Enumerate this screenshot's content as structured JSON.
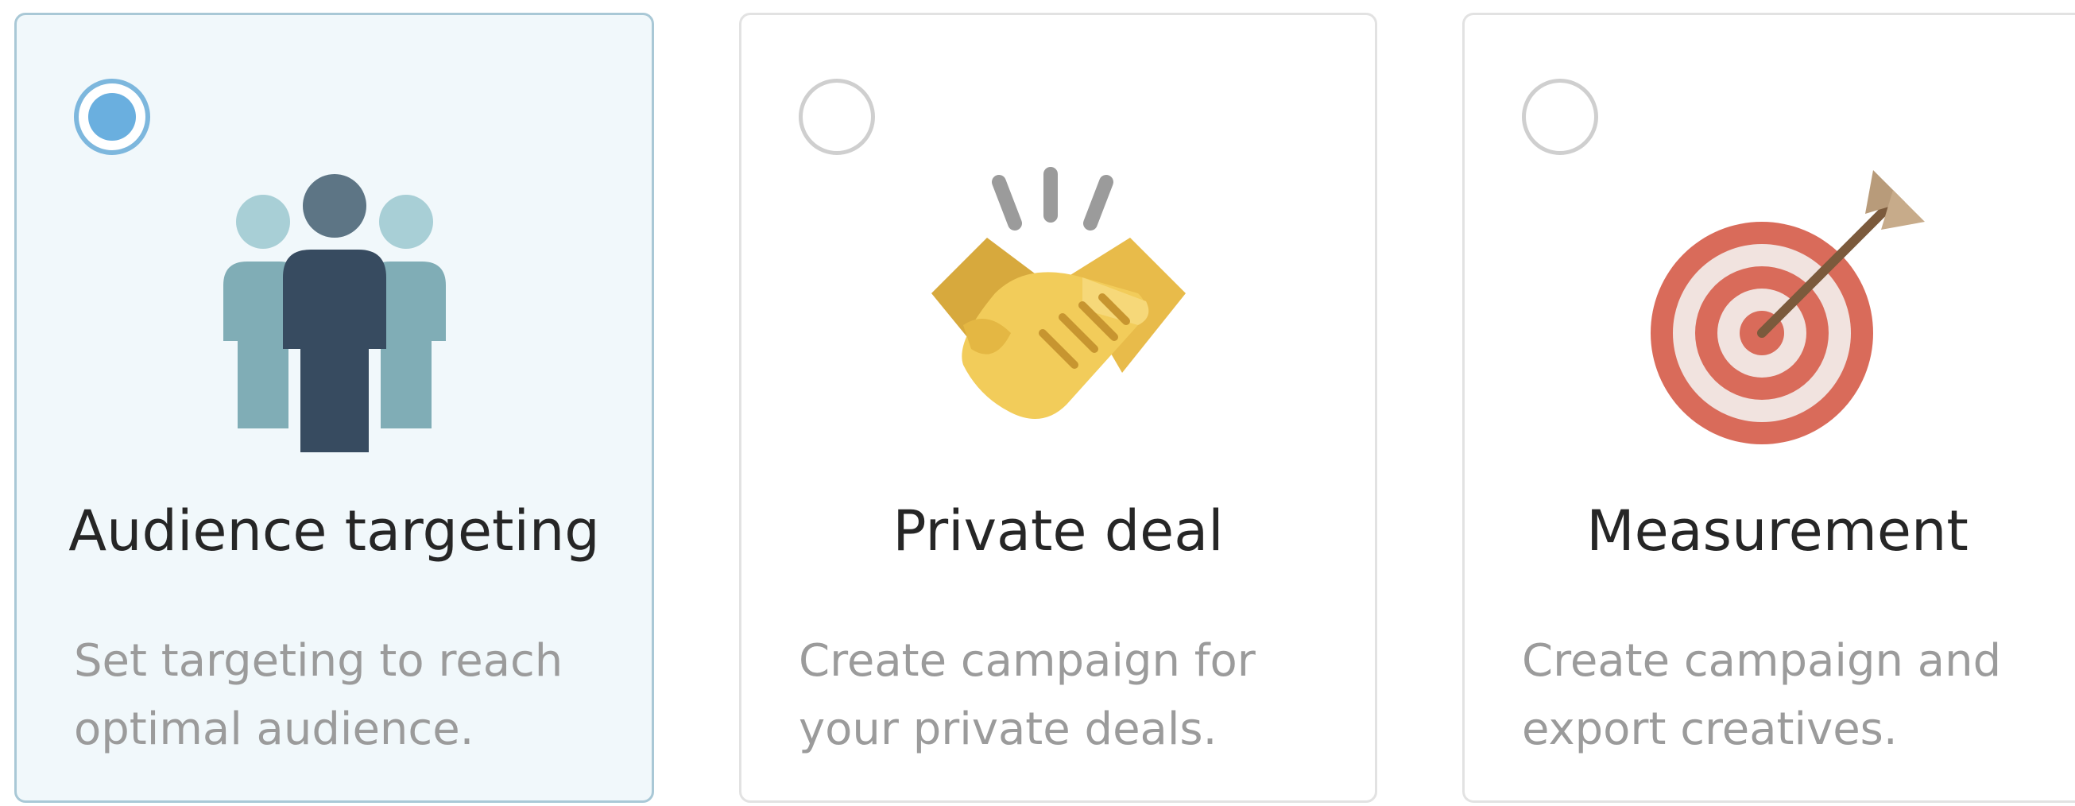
{
  "cards": [
    {
      "title": "Audience targeting",
      "description": [
        "Set targeting to reach",
        "optimal audience."
      ],
      "icon": "audience-group-icon",
      "selected": true
    },
    {
      "title": "Private deal",
      "description": [
        "Create campaign for",
        "your private deals."
      ],
      "icon": "handshake-icon",
      "selected": false
    },
    {
      "title": "Measurement",
      "description": [
        "Create campaign and",
        "export creatives."
      ],
      "icon": "target-arrow-icon",
      "selected": false
    }
  ],
  "colors": {
    "selected_bg": "#f1f8fb",
    "selected_border": "#a9c8d6",
    "radio_selected": "#6aafdf",
    "title_text": "#262626",
    "desc_text": "#9b9b9b"
  }
}
